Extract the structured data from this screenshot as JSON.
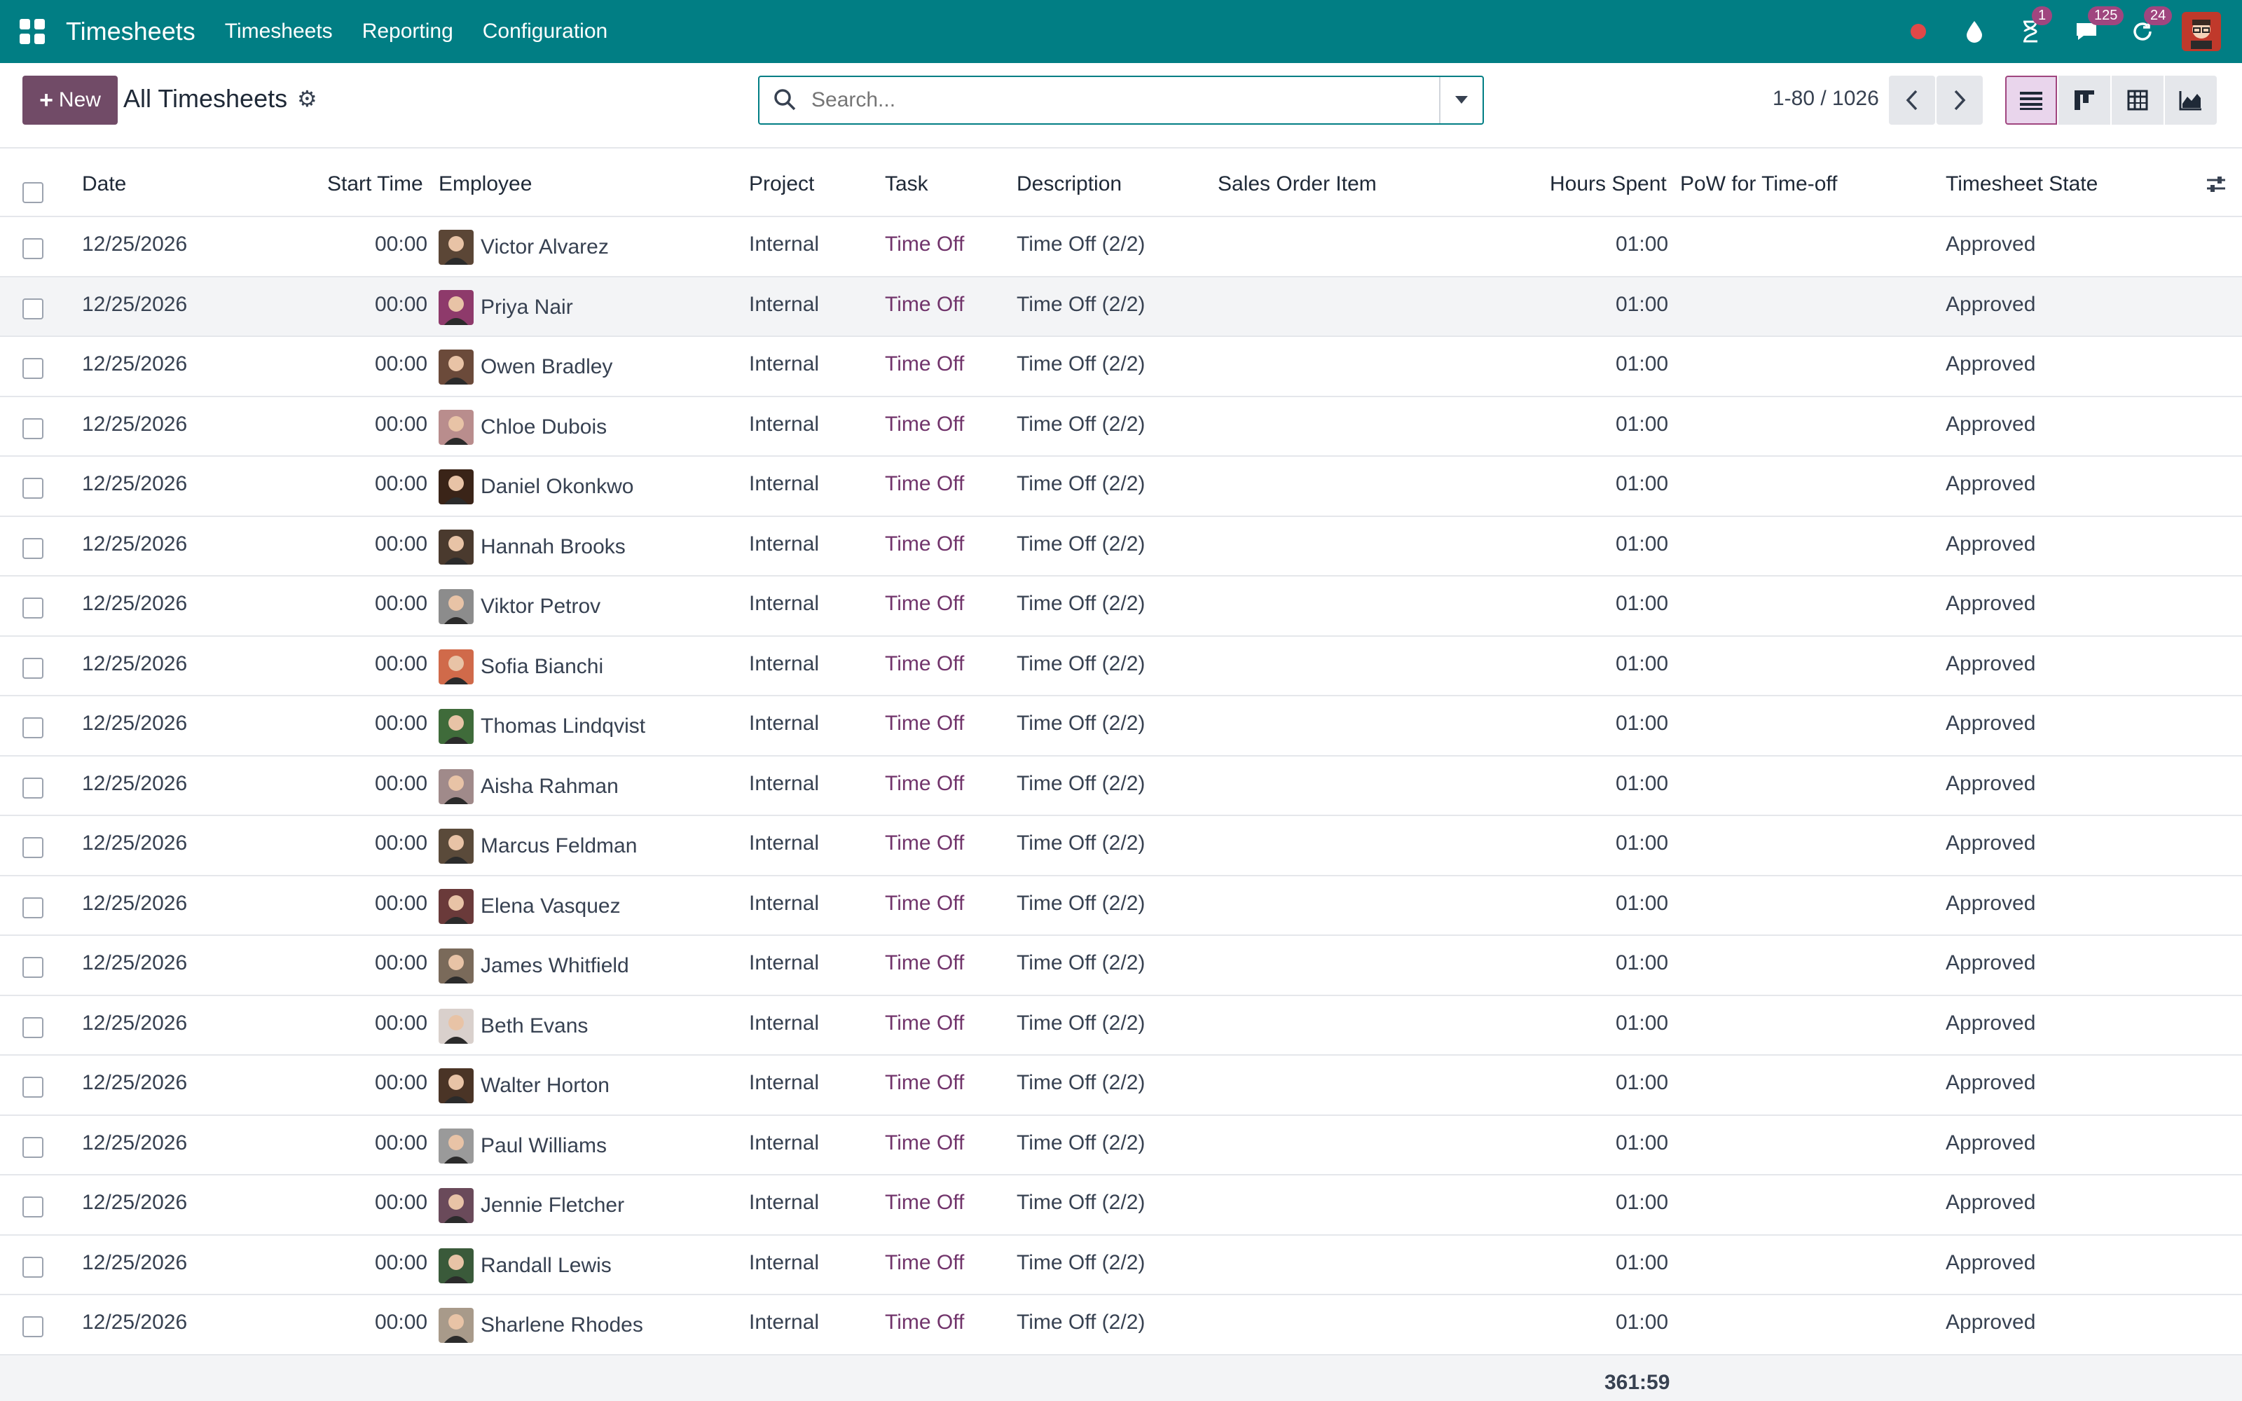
{
  "navbar": {
    "app_title": "Timesheets",
    "menu": [
      "Timesheets",
      "Reporting",
      "Configuration"
    ],
    "activity_badge": "1",
    "messages_badge": "125",
    "updates_badge": "24",
    "bg_color": "#017e84"
  },
  "control": {
    "new_label": "New",
    "title": "All Timesheets",
    "search_placeholder": "Search...",
    "pager": "1-80 / 1026",
    "views": [
      "list-icon",
      "kanban-icon",
      "pivot-icon",
      "graph-icon"
    ],
    "active_view": "list"
  },
  "table": {
    "headers": {
      "date": "Date",
      "start_time": "Start Time",
      "employee": "Employee",
      "project": "Project",
      "task": "Task",
      "description": "Description",
      "sales_order_item": "Sales Order Item",
      "hours_spent": "Hours Spent",
      "pow": "PoW for Time-off",
      "state": "Timesheet State"
    },
    "rows": [
      {
        "date": "12/25/2026",
        "start": "00:00",
        "employee": "Victor Alvarez",
        "project": "Internal",
        "task": "Time Off",
        "description": "Time Off (2/2)",
        "hours": "01:00",
        "state": "Approved",
        "avatar_color": "#5b4636"
      },
      {
        "date": "12/25/2026",
        "start": "00:00",
        "employee": "Priya Nair",
        "project": "Internal",
        "task": "Time Off",
        "description": "Time Off (2/2)",
        "hours": "01:00",
        "state": "Approved",
        "avatar_color": "#8e3a6b"
      },
      {
        "date": "12/25/2026",
        "start": "00:00",
        "employee": "Owen Bradley",
        "project": "Internal",
        "task": "Time Off",
        "description": "Time Off (2/2)",
        "hours": "01:00",
        "state": "Approved",
        "avatar_color": "#6b4a3a"
      },
      {
        "date": "12/25/2026",
        "start": "00:00",
        "employee": "Chloe Dubois",
        "project": "Internal",
        "task": "Time Off",
        "description": "Time Off (2/2)",
        "hours": "01:00",
        "state": "Approved",
        "avatar_color": "#b98d8d"
      },
      {
        "date": "12/25/2026",
        "start": "00:00",
        "employee": "Daniel Okonkwo",
        "project": "Internal",
        "task": "Time Off",
        "description": "Time Off (2/2)",
        "hours": "01:00",
        "state": "Approved",
        "avatar_color": "#3a2418"
      },
      {
        "date": "12/25/2026",
        "start": "00:00",
        "employee": "Hannah Brooks",
        "project": "Internal",
        "task": "Time Off",
        "description": "Time Off (2/2)",
        "hours": "01:00",
        "state": "Approved",
        "avatar_color": "#4a3a2e"
      },
      {
        "date": "12/25/2026",
        "start": "00:00",
        "employee": "Viktor Petrov",
        "project": "Internal",
        "task": "Time Off",
        "description": "Time Off (2/2)",
        "hours": "01:00",
        "state": "Approved",
        "avatar_color": "#8c8c8c"
      },
      {
        "date": "12/25/2026",
        "start": "00:00",
        "employee": "Sofia Bianchi",
        "project": "Internal",
        "task": "Time Off",
        "description": "Time Off (2/2)",
        "hours": "01:00",
        "state": "Approved",
        "avatar_color": "#d06a4a"
      },
      {
        "date": "12/25/2026",
        "start": "00:00",
        "employee": "Thomas Lindqvist",
        "project": "Internal",
        "task": "Time Off",
        "description": "Time Off (2/2)",
        "hours": "01:00",
        "state": "Approved",
        "avatar_color": "#3f6b3a"
      },
      {
        "date": "12/25/2026",
        "start": "00:00",
        "employee": "Aisha Rahman",
        "project": "Internal",
        "task": "Time Off",
        "description": "Time Off (2/2)",
        "hours": "01:00",
        "state": "Approved",
        "avatar_color": "#a08a8a"
      },
      {
        "date": "12/25/2026",
        "start": "00:00",
        "employee": "Marcus Feldman",
        "project": "Internal",
        "task": "Time Off",
        "description": "Time Off (2/2)",
        "hours": "01:00",
        "state": "Approved",
        "avatar_color": "#5a4a3a"
      },
      {
        "date": "12/25/2026",
        "start": "00:00",
        "employee": "Elena Vasquez",
        "project": "Internal",
        "task": "Time Off",
        "description": "Time Off (2/2)",
        "hours": "01:00",
        "state": "Approved",
        "avatar_color": "#6a3a3a"
      },
      {
        "date": "12/25/2026",
        "start": "00:00",
        "employee": "James Whitfield",
        "project": "Internal",
        "task": "Time Off",
        "description": "Time Off (2/2)",
        "hours": "01:00",
        "state": "Approved",
        "avatar_color": "#7a6a5a"
      },
      {
        "date": "12/25/2026",
        "start": "00:00",
        "employee": "Beth Evans",
        "project": "Internal",
        "task": "Time Off",
        "description": "Time Off (2/2)",
        "hours": "01:00",
        "state": "Approved",
        "avatar_color": "#d9d0cc"
      },
      {
        "date": "12/25/2026",
        "start": "00:00",
        "employee": "Walter Horton",
        "project": "Internal",
        "task": "Time Off",
        "description": "Time Off (2/2)",
        "hours": "01:00",
        "state": "Approved",
        "avatar_color": "#4a3426"
      },
      {
        "date": "12/25/2026",
        "start": "00:00",
        "employee": "Paul Williams",
        "project": "Internal",
        "task": "Time Off",
        "description": "Time Off (2/2)",
        "hours": "01:00",
        "state": "Approved",
        "avatar_color": "#9a9a9a"
      },
      {
        "date": "12/25/2026",
        "start": "00:00",
        "employee": "Jennie Fletcher",
        "project": "Internal",
        "task": "Time Off",
        "description": "Time Off (2/2)",
        "hours": "01:00",
        "state": "Approved",
        "avatar_color": "#6a4a5a"
      },
      {
        "date": "12/25/2026",
        "start": "00:00",
        "employee": "Randall Lewis",
        "project": "Internal",
        "task": "Time Off",
        "description": "Time Off (2/2)",
        "hours": "01:00",
        "state": "Approved",
        "avatar_color": "#3a5a3a"
      },
      {
        "date": "12/25/2026",
        "start": "00:00",
        "employee": "Sharlene Rhodes",
        "project": "Internal",
        "task": "Time Off",
        "description": "Time Off (2/2)",
        "hours": "01:00",
        "state": "Approved",
        "avatar_color": "#a89a8a"
      }
    ],
    "total_hours": "361:59",
    "accent_link_color": "#71346b",
    "hovered_row": 1
  }
}
